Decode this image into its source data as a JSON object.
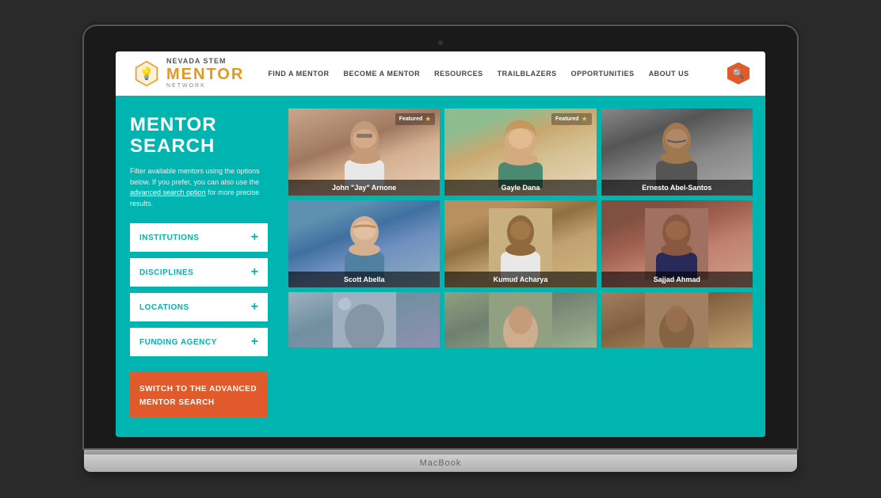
{
  "laptop": {
    "brand": "MacBook"
  },
  "header": {
    "logo": {
      "top": "NEVADA STEM",
      "main": "MENTOR",
      "bottom": "NETWORK"
    },
    "nav": [
      {
        "label": "FIND A MENTOR"
      },
      {
        "label": "BECOME A MENTOR"
      },
      {
        "label": "RESOURCES"
      },
      {
        "label": "TRAILBLAZERS"
      },
      {
        "label": "OPPORTUNITIES"
      },
      {
        "label": "ABOUT US"
      }
    ],
    "search_label": "search"
  },
  "sidebar": {
    "title": "MENTOR SEARCH",
    "description_part1": "Filter available mentors using the options below. If you prefer, you can also use the ",
    "description_link": "advanced search option",
    "description_part2": " for more precise results.",
    "filters": [
      {
        "label": "INSTITUTIONS",
        "id": "institutions"
      },
      {
        "label": "DISCIPLINES",
        "id": "disciplines"
      },
      {
        "label": "LOCATIONS",
        "id": "locations"
      },
      {
        "label": "FUNDING AGENCY",
        "id": "funding-agency"
      }
    ],
    "advanced_btn": "SWITCH TO THE ADVANCED MENTOR SEARCH"
  },
  "mentors": {
    "row1": [
      {
        "name": "John \"Jay\" Arnone",
        "featured": true,
        "photo_class": "photo-jay"
      },
      {
        "name": "Gayle Dana",
        "featured": true,
        "photo_class": "photo-gayle"
      },
      {
        "name": "Ernesto Abel-Santos",
        "featured": false,
        "photo_class": "photo-ernesto"
      }
    ],
    "row2": [
      {
        "name": "Scott Abella",
        "featured": false,
        "photo_class": "photo-scott"
      },
      {
        "name": "Kumud Acharya",
        "featured": false,
        "photo_class": "photo-kumud"
      },
      {
        "name": "Sajjad Ahmad",
        "featured": false,
        "photo_class": "photo-sajjad"
      }
    ],
    "row3": [
      {
        "name": "",
        "featured": false,
        "photo_class": "photo-partial1",
        "partial": true
      },
      {
        "name": "",
        "featured": false,
        "photo_class": "photo-partial2",
        "partial": true
      },
      {
        "name": "",
        "featured": false,
        "photo_class": "photo-partial3",
        "partial": true
      }
    ]
  }
}
